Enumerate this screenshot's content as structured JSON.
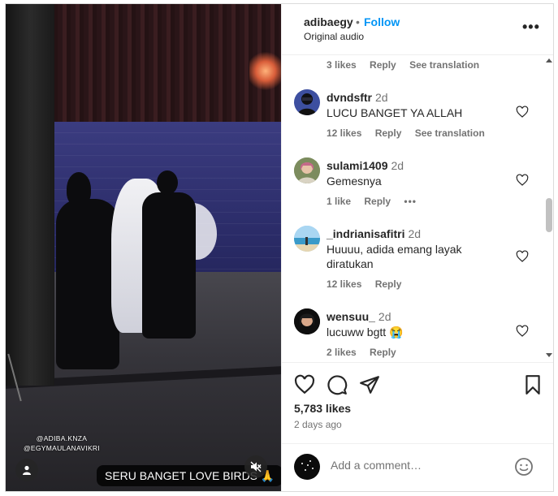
{
  "media": {
    "credit_line_1": "@ADIBA.KNZA",
    "credit_line_2": "@EGYMAULANAVIKRI",
    "caption_text": "SERU BANGET LOVE BIRDS 🙏"
  },
  "header": {
    "username": "adibaegy",
    "separator": "•",
    "follow_label": "Follow",
    "audio_label": "Original audio",
    "more_label": "•••"
  },
  "comments": {
    "top_meta": {
      "likes": "3 likes",
      "reply": "Reply",
      "translate": "See translation"
    },
    "items": [
      {
        "user": "dvndsftr",
        "time": "2d",
        "text": "LUCU BANGET YA ALLAH",
        "likes": "12 likes",
        "reply": "Reply",
        "translate": "See translation",
        "avatar_icon": "avatar-person-icon"
      },
      {
        "user": "sulami1409",
        "time": "2d",
        "text": "Gemesnya",
        "likes": "1 like",
        "reply": "Reply",
        "more": "•••",
        "avatar_icon": "avatar-person-icon"
      },
      {
        "user": "_indrianisafitri",
        "time": "2d",
        "text": "Huuuu, adida emang layak diratukan",
        "likes": "12 likes",
        "reply": "Reply",
        "avatar_icon": "avatar-beach-icon"
      },
      {
        "user": "wensuu_",
        "time": "2d",
        "text": "lucuww bgtt 😭",
        "likes": "2 likes",
        "reply": "Reply",
        "avatar_icon": "avatar-person-icon"
      }
    ]
  },
  "actions": {
    "likes_count": "5,783 likes",
    "posted_ago": "2 days ago"
  },
  "add_comment": {
    "placeholder": "Add a comment…"
  },
  "colors": {
    "follow_blue": "#0095f6",
    "secondary_text": "#737373",
    "primary_text": "#262626"
  }
}
